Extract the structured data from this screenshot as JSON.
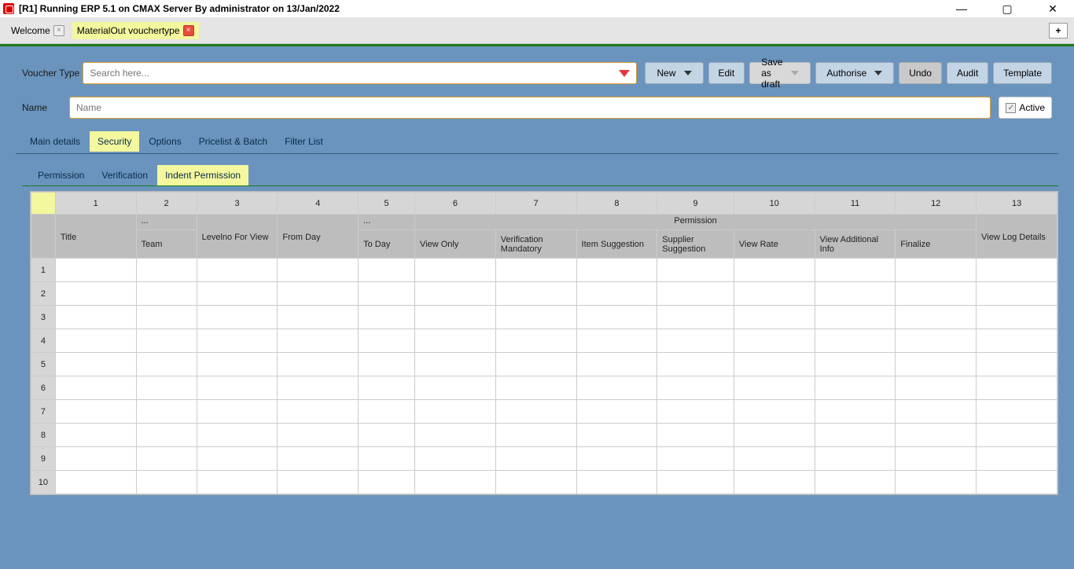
{
  "window": {
    "title": "[R1] Running ERP 5.1 on CMAX Server By administrator on 13/Jan/2022"
  },
  "tabs": {
    "items": [
      {
        "label": "Welcome",
        "active": false
      },
      {
        "label": "MaterialOut vouchertype",
        "active": true
      }
    ],
    "add": "+"
  },
  "form": {
    "voucher_type_label": "Voucher Type",
    "search_placeholder": "Search here...",
    "name_label": "Name",
    "name_placeholder": "Name",
    "active_label": "Active"
  },
  "toolbar": {
    "new": "New",
    "edit": "Edit",
    "save_draft": "Save as draft",
    "authorise": "Authorise",
    "undo": "Undo",
    "audit": "Audit",
    "template": "Template"
  },
  "section_tabs": [
    "Main details",
    "Security",
    "Options",
    "Pricelist & Batch",
    "Filter List"
  ],
  "sub_tabs": [
    "Permission",
    "Verification",
    "Indent Permission"
  ],
  "grid": {
    "col_numbers": [
      "1",
      "2",
      "3",
      "4",
      "5",
      "6",
      "7",
      "8",
      "9",
      "10",
      "11",
      "12",
      "13"
    ],
    "group_permission": "Permission",
    "ellipsis": "...",
    "headers": {
      "title": "Title",
      "team": "Team",
      "levelno": "Levelno For View",
      "from_day": "From Day",
      "to_day": "To Day",
      "view_only": "View Only",
      "verification": "Verification Mandatory",
      "item_sugg": "Item Suggestion",
      "supplier_sugg": "Supplier Suggestion",
      "view_rate": "View Rate",
      "view_add": "View Additional Info",
      "finalize": "Finalize",
      "view_log": "View Log Details"
    },
    "row_numbers": [
      "1",
      "2",
      "3",
      "4",
      "5",
      "6",
      "7",
      "8",
      "9",
      "10"
    ]
  }
}
